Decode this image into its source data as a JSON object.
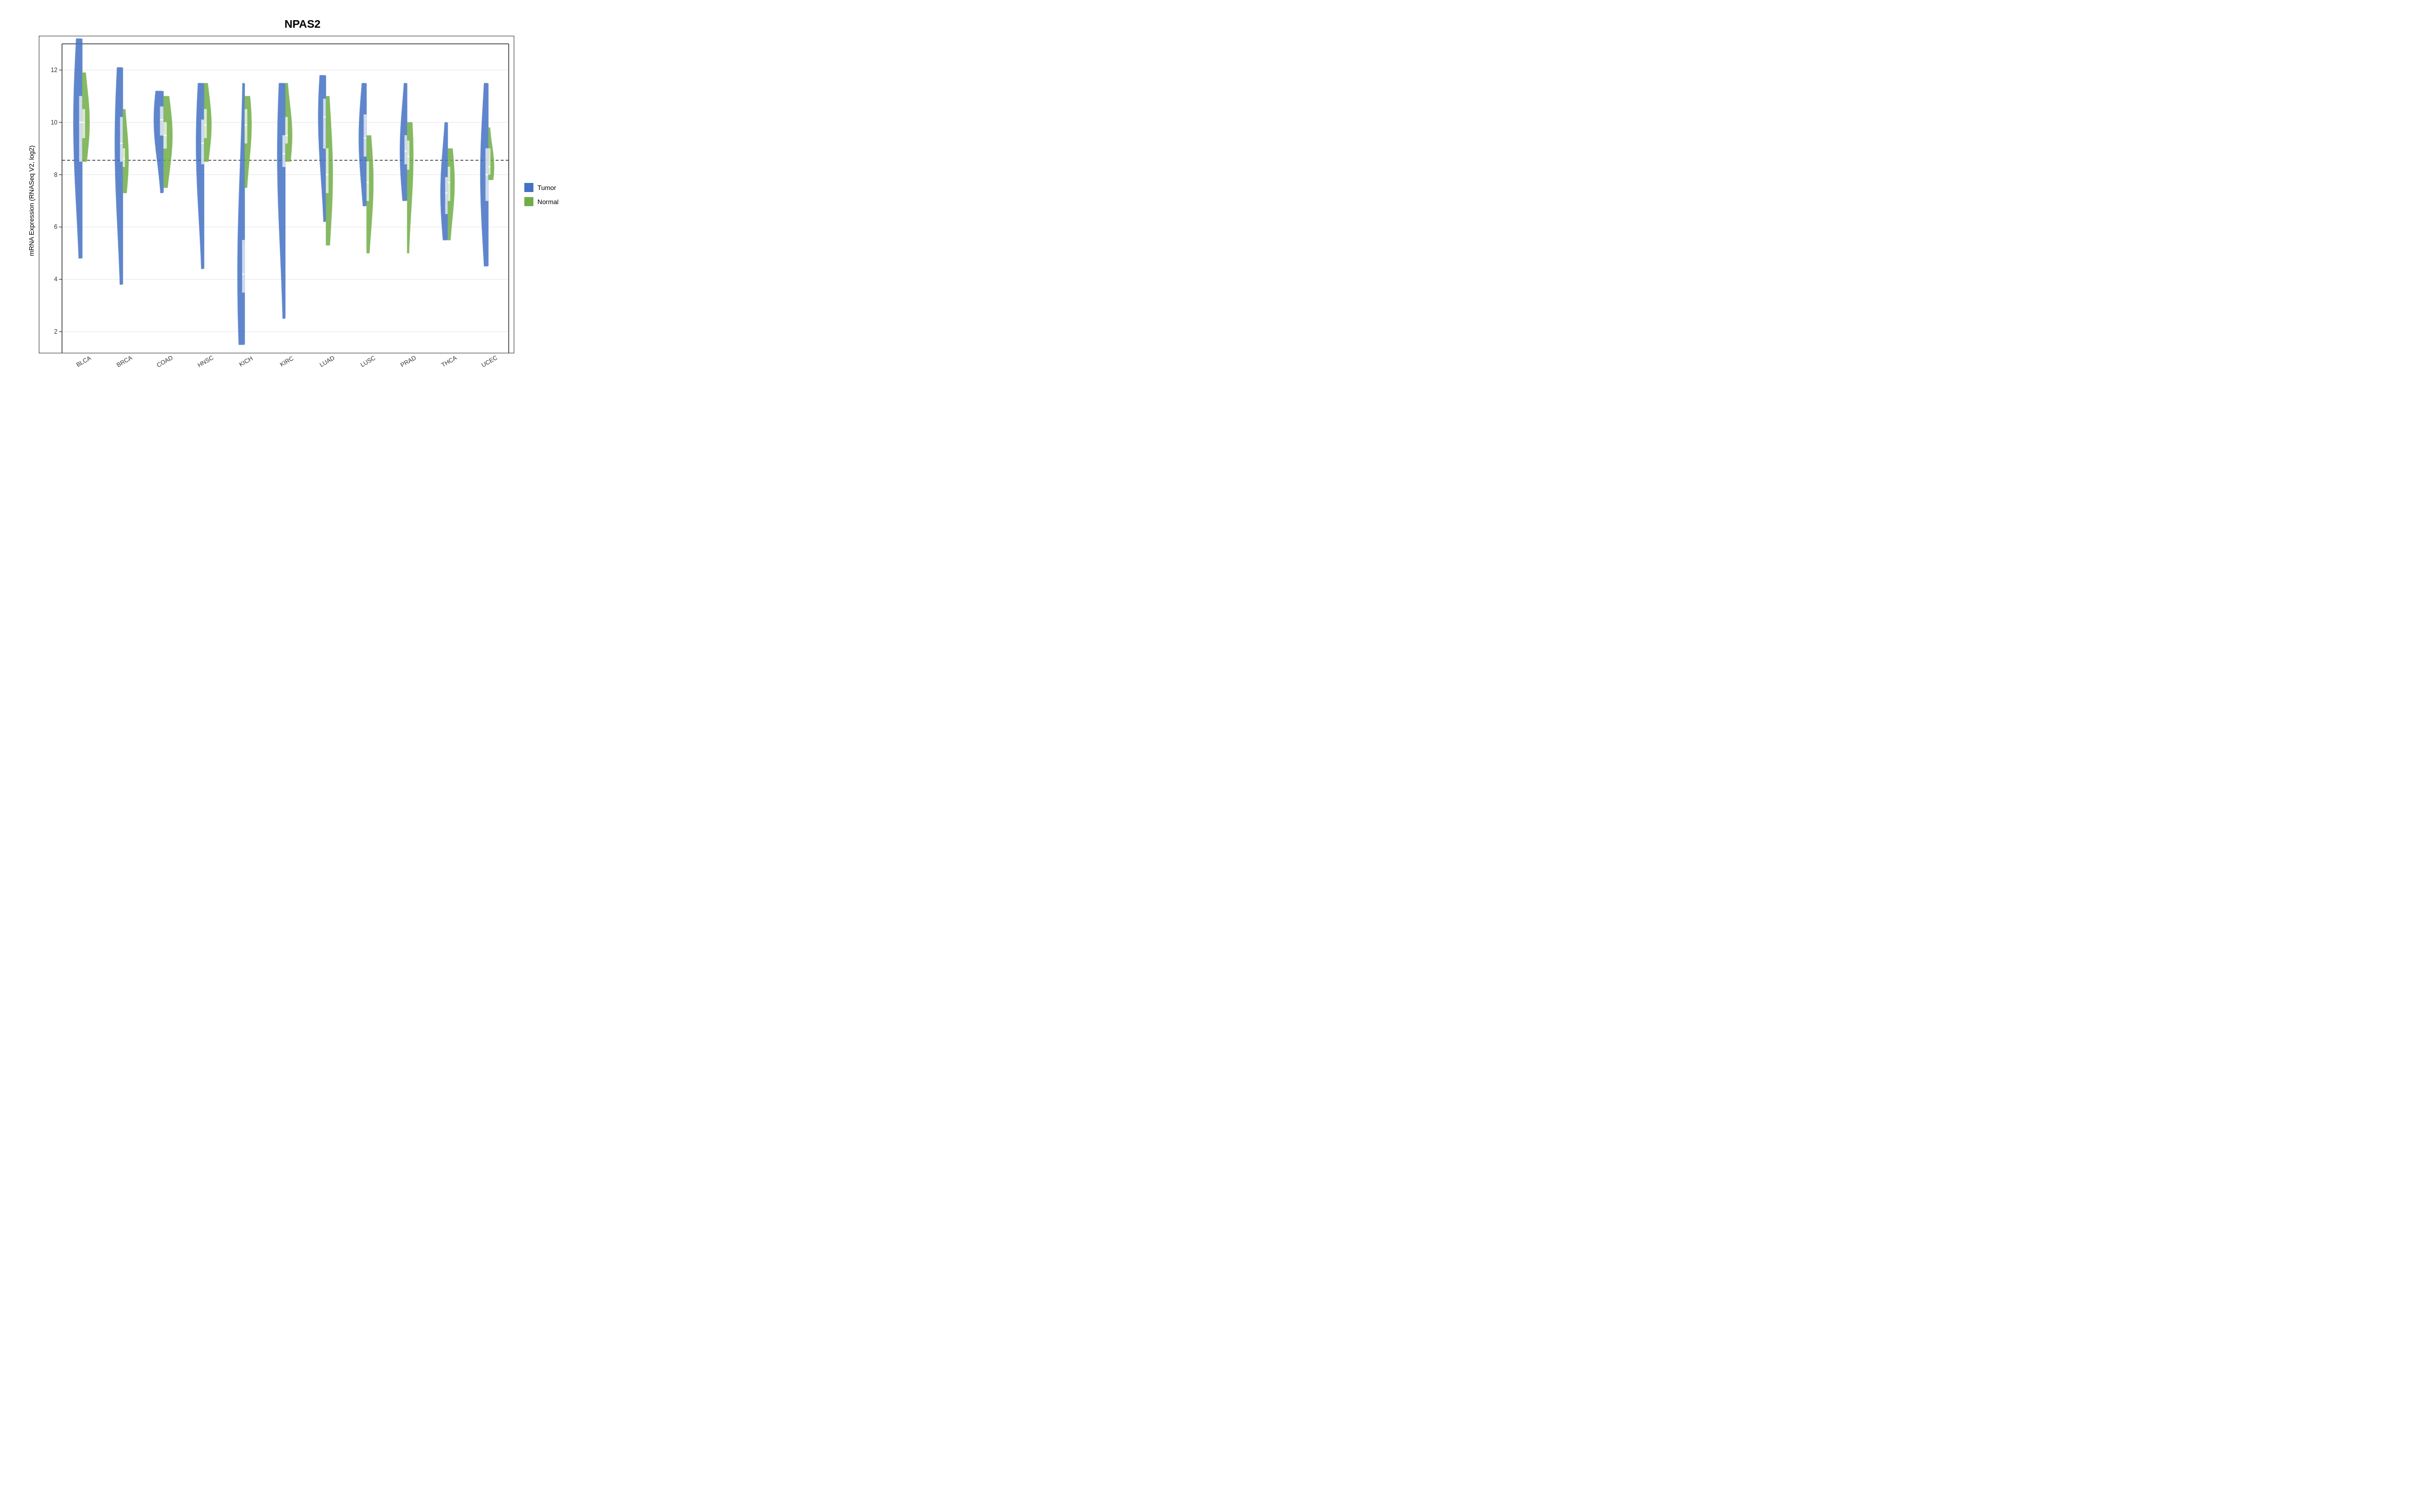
{
  "title": "NPAS2",
  "y_axis_label": "mRNA Expression (RNASeq V2, log2)",
  "x_axis_categories": [
    "BLCA",
    "BRCA",
    "COAD",
    "HNSC",
    "KICH",
    "KIRC",
    "LUAD",
    "LUSC",
    "PRAD",
    "THCA",
    "UCEC"
  ],
  "legend": {
    "items": [
      {
        "label": "Tumor",
        "color": "#4472C4"
      },
      {
        "label": "Normal",
        "color": "#70AD47"
      }
    ]
  },
  "y_axis": {
    "min": 1,
    "max": 13,
    "ticks": [
      2,
      4,
      6,
      8,
      10,
      12
    ],
    "reference_line": 8.55
  },
  "violins": [
    {
      "cancer": "BLCA",
      "tumor": {
        "min": 4.8,
        "q1": 8.5,
        "median": 10.0,
        "q3": 11.0,
        "max": 13.2,
        "width": 0.55
      },
      "normal": {
        "min": 8.5,
        "q1": 9.4,
        "median": 10.0,
        "q3": 10.5,
        "max": 11.9,
        "width": 0.45
      }
    },
    {
      "cancer": "BRCA",
      "tumor": {
        "min": 3.8,
        "q1": 8.5,
        "median": 9.2,
        "q3": 10.2,
        "max": 12.1,
        "width": 0.5
      },
      "normal": {
        "min": 7.3,
        "q1": 8.3,
        "median": 8.6,
        "q3": 9.0,
        "max": 10.5,
        "width": 0.35
      }
    },
    {
      "cancer": "COAD",
      "tumor": {
        "min": 7.3,
        "q1": 9.5,
        "median": 10.1,
        "q3": 10.6,
        "max": 11.2,
        "width": 0.6
      },
      "normal": {
        "min": 7.5,
        "q1": 9.0,
        "median": 9.5,
        "q3": 10.0,
        "max": 11.0,
        "width": 0.55
      }
    },
    {
      "cancer": "HNSC",
      "tumor": {
        "min": 4.4,
        "q1": 8.4,
        "median": 9.2,
        "q3": 10.1,
        "max": 11.5,
        "width": 0.5
      },
      "normal": {
        "min": 8.5,
        "q1": 9.4,
        "median": 9.9,
        "q3": 10.5,
        "max": 11.5,
        "width": 0.45
      }
    },
    {
      "cancer": "KICH",
      "tumor": {
        "min": 1.5,
        "q1": 3.5,
        "median": 4.2,
        "q3": 5.5,
        "max": 11.5,
        "width": 0.45
      },
      "normal": {
        "min": 7.5,
        "q1": 9.2,
        "median": 9.9,
        "q3": 10.5,
        "max": 11.0,
        "width": 0.42
      }
    },
    {
      "cancer": "KIRC",
      "tumor": {
        "min": 2.5,
        "q1": 8.3,
        "median": 8.8,
        "q3": 9.5,
        "max": 11.5,
        "width": 0.5
      },
      "normal": {
        "min": 8.5,
        "q1": 9.2,
        "median": 9.5,
        "q3": 10.2,
        "max": 11.5,
        "width": 0.42
      }
    },
    {
      "cancer": "LUAD",
      "tumor": {
        "min": 6.2,
        "q1": 9.0,
        "median": 10.2,
        "q3": 10.9,
        "max": 11.8,
        "width": 0.48
      },
      "normal": {
        "min": 5.3,
        "q1": 7.3,
        "median": 8.0,
        "q3": 9.0,
        "max": 11.0,
        "width": 0.42
      }
    },
    {
      "cancer": "LUSC",
      "tumor": {
        "min": 6.8,
        "q1": 8.7,
        "median": 9.4,
        "q3": 10.3,
        "max": 11.5,
        "width": 0.48
      },
      "normal": {
        "min": 5.0,
        "q1": 7.0,
        "median": 7.7,
        "q3": 8.5,
        "max": 9.5,
        "width": 0.42
      }
    },
    {
      "cancer": "PRAD",
      "tumor": {
        "min": 7.0,
        "q1": 8.4,
        "median": 8.9,
        "q3": 9.5,
        "max": 11.5,
        "width": 0.45
      },
      "normal": {
        "min": 5.0,
        "q1": 8.2,
        "median": 8.7,
        "q3": 9.3,
        "max": 10.0,
        "width": 0.38
      }
    },
    {
      "cancer": "THCA",
      "tumor": {
        "min": 5.5,
        "q1": 6.5,
        "median": 7.3,
        "q3": 7.9,
        "max": 10.0,
        "width": 0.45
      },
      "normal": {
        "min": 5.5,
        "q1": 7.0,
        "median": 7.7,
        "q3": 8.3,
        "max": 9.0,
        "width": 0.42
      }
    },
    {
      "cancer": "UCEC",
      "tumor": {
        "min": 4.5,
        "q1": 7.0,
        "median": 8.0,
        "q3": 9.0,
        "max": 11.5,
        "width": 0.5
      },
      "normal": {
        "min": 7.8,
        "q1": 8.0,
        "median": 8.3,
        "q3": 9.0,
        "max": 9.8,
        "width": 0.35
      }
    }
  ],
  "colors": {
    "tumor": "#4472C4",
    "normal": "#70AD47",
    "border": "#333333",
    "reference_line": "#333333",
    "white": "#ffffff"
  }
}
